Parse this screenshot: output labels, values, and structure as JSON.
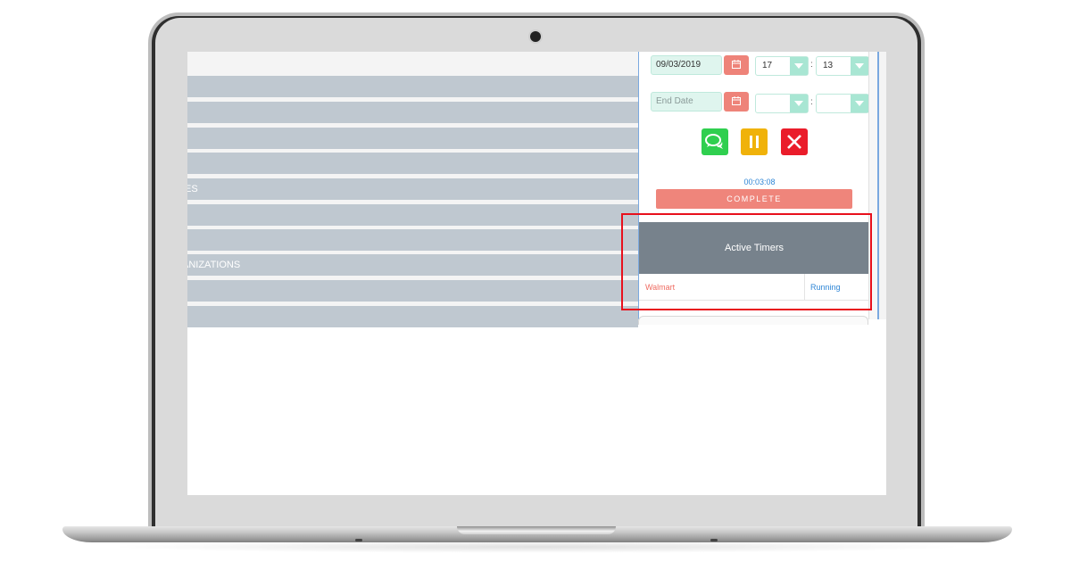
{
  "device": {
    "type": "laptop-mockup"
  },
  "sidebar": {
    "rows": [
      {
        "label": ""
      },
      {
        "label": ""
      },
      {
        "label": ""
      },
      {
        "label": ""
      },
      {
        "label": "IES"
      },
      {
        "label": ""
      },
      {
        "label": ""
      },
      {
        "label": "ANIZATIONS"
      },
      {
        "label": ""
      },
      {
        "label": ""
      }
    ]
  },
  "timer_form": {
    "start_date": {
      "value": "09/03/2019",
      "icon": "calendar-icon"
    },
    "start_hour": {
      "value": "17"
    },
    "start_minute": {
      "value": "13"
    },
    "end_date": {
      "value": "",
      "placeholder": "End Date",
      "icon": "calendar-icon"
    },
    "end_hour": {
      "value": ""
    },
    "end_minute": {
      "value": ""
    },
    "time_separator": ":",
    "actions": [
      {
        "name": "comment",
        "icon": "chat-bubbles-icon",
        "color": "#2fcf4f"
      },
      {
        "name": "pause",
        "icon": "pause-icon",
        "color": "#f0b20a"
      },
      {
        "name": "cancel",
        "icon": "close-icon",
        "color": "#ea1c2a"
      }
    ],
    "elapsed": "00:03:08",
    "complete_label": "COMPLETE"
  },
  "active_timers": {
    "title": "Active Timers",
    "rows": [
      {
        "name": "Walmart",
        "status": "Running"
      }
    ]
  },
  "colors": {
    "accent_red": "#ef857b",
    "accent_teal": "#a8e6d3",
    "link_blue": "#2f86d6",
    "header_gray": "#77828c",
    "highlight": "#e8101c"
  }
}
